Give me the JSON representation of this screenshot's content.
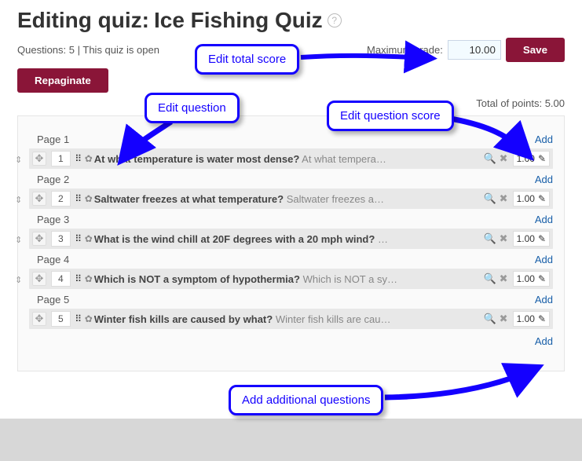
{
  "header": {
    "title_prefix": "Editing quiz: ",
    "quiz_name": "Ice Fishing Quiz",
    "help_icon": "?"
  },
  "summary": {
    "questions_label": "Questions: 5",
    "separator": " | ",
    "open_label": "This quiz is open"
  },
  "max_grade": {
    "label": "Maximum grade:",
    "value": "10.00"
  },
  "buttons": {
    "save": "Save",
    "repaginate": "Repaginate"
  },
  "totals": {
    "line": "Total of points: 5.00"
  },
  "links": {
    "add": "Add"
  },
  "pages": [
    {
      "label": "Page 1",
      "num": "1",
      "title": "At what temperature is water most dense?",
      "tail": "At what tempera…",
      "score": "1.00"
    },
    {
      "label": "Page 2",
      "num": "2",
      "title": "Saltwater freezes at what temperature?",
      "tail": "Saltwater freezes a…",
      "score": "1.00"
    },
    {
      "label": "Page 3",
      "num": "3",
      "title": "What is the wind chill at 20F degrees with a 20 mph wind?",
      "tail": "…",
      "score": "1.00"
    },
    {
      "label": "Page 4",
      "num": "4",
      "title": "Which is NOT a symptom of hypothermia?",
      "tail": "Which is NOT a sy…",
      "score": "1.00"
    },
    {
      "label": "Page 5",
      "num": "5",
      "title": "Winter fish kills are caused by what?",
      "tail": "Winter fish kills are cau…",
      "score": "1.00"
    }
  ],
  "callouts": {
    "edit_total_score": "Edit total score",
    "edit_question": "Edit question",
    "edit_question_score": "Edit question score",
    "add_questions": "Add additional questions"
  }
}
